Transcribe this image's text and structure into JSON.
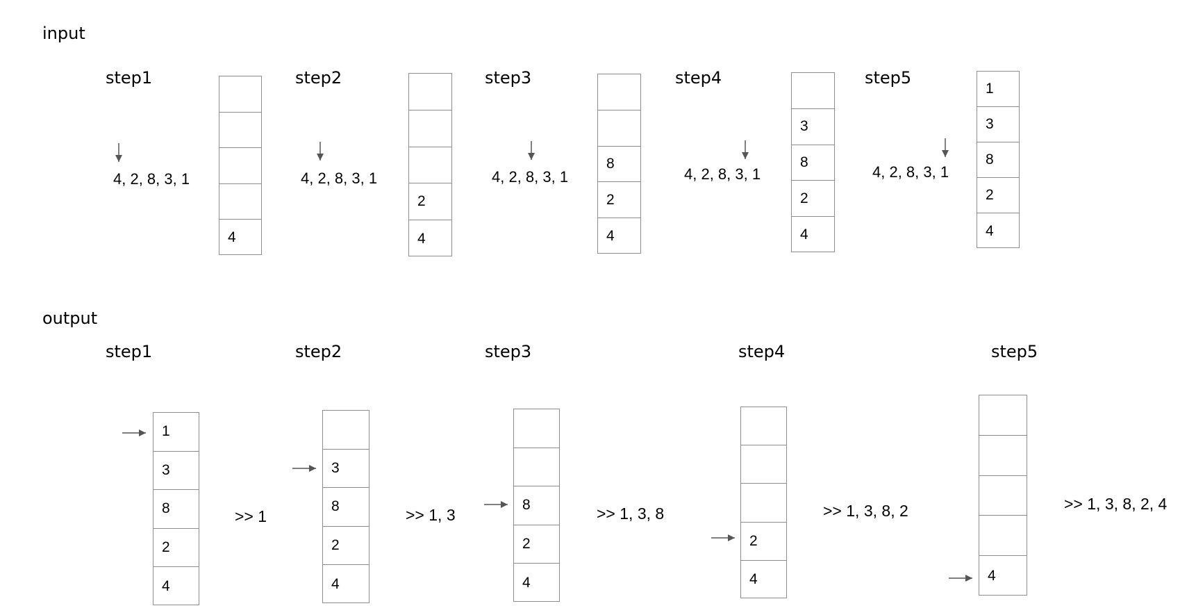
{
  "input": {
    "label": "input",
    "steps": [
      {
        "label": "step1",
        "sequence": "4, 2, 8, 3, 1",
        "stack": [
          "",
          "",
          "",
          "",
          "4"
        ]
      },
      {
        "label": "step2",
        "sequence": "4, 2, 8, 3, 1",
        "stack": [
          "",
          "",
          "",
          "2",
          "4"
        ]
      },
      {
        "label": "step3",
        "sequence": "4, 2, 8, 3, 1",
        "stack": [
          "",
          "",
          "8",
          "2",
          "4"
        ]
      },
      {
        "label": "step4",
        "sequence": "4, 2, 8, 3, 1",
        "stack": [
          "",
          "3",
          "8",
          "2",
          "4"
        ]
      },
      {
        "label": "step5",
        "sequence": "4, 2, 8, 3, 1",
        "stack": [
          "1",
          "3",
          "8",
          "2",
          "4"
        ]
      }
    ]
  },
  "output": {
    "label": "output",
    "steps": [
      {
        "label": "step1",
        "stack": [
          "1",
          "3",
          "8",
          "2",
          "4"
        ],
        "result": ">> 1"
      },
      {
        "label": "step2",
        "stack": [
          "",
          "3",
          "8",
          "2",
          "4"
        ],
        "result": ">> 1, 3"
      },
      {
        "label": "step3",
        "stack": [
          "",
          "",
          "8",
          "2",
          "4"
        ],
        "result": ">> 1, 3, 8"
      },
      {
        "label": "step4",
        "stack": [
          "",
          "",
          "",
          "2",
          "4"
        ],
        "result": ">> 1, 3, 8, 2"
      },
      {
        "label": "step5",
        "stack": [
          "",
          "",
          "",
          "",
          "4"
        ],
        "result": ">> 1, 3, 8, 2, 4"
      }
    ]
  },
  "colors": {
    "stroke": "#8c8c8c",
    "arrow": "#555555",
    "text": "#000000"
  }
}
